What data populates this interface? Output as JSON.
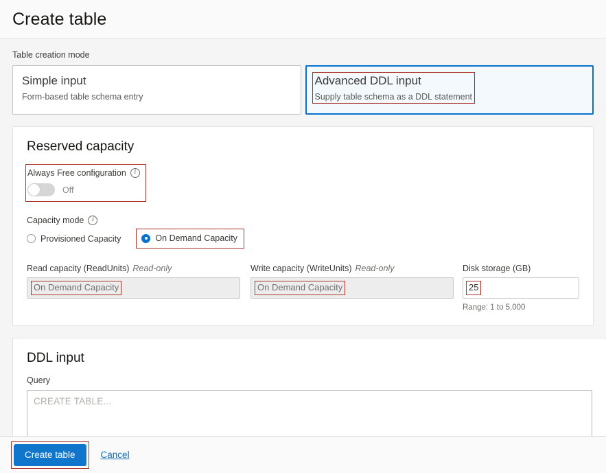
{
  "header": {
    "title": "Create table"
  },
  "creation_mode": {
    "label": "Table creation mode",
    "tiles": [
      {
        "title": "Simple input",
        "subtitle": "Form-based table schema entry",
        "selected": false
      },
      {
        "title": "Advanced DDL input",
        "subtitle": "Supply table schema as a DDL statement",
        "selected": true
      }
    ]
  },
  "reserved_capacity": {
    "title": "Reserved capacity",
    "always_free": {
      "label": "Always Free configuration",
      "info_icon": "info-icon",
      "state": "Off",
      "checked": false
    },
    "capacity_mode": {
      "label": "Capacity mode",
      "info_icon": "info-icon",
      "options": [
        {
          "label": "Provisioned Capacity",
          "selected": false
        },
        {
          "label": "On Demand Capacity",
          "selected": true
        }
      ]
    },
    "read_capacity": {
      "label": "Read capacity (ReadUnits)",
      "readonly_tag": "Read-only",
      "value": "On Demand Capacity"
    },
    "write_capacity": {
      "label": "Write capacity (WriteUnits)",
      "readonly_tag": "Read-only",
      "value": "On Demand Capacity"
    },
    "disk_storage": {
      "label": "Disk storage (GB)",
      "value": "25",
      "hint": "Range: 1 to 5,000"
    }
  },
  "ddl_input": {
    "title": "DDL input",
    "query_label": "Query",
    "query_placeholder": "CREATE TABLE..."
  },
  "footer": {
    "submit_label": "Create table",
    "cancel_label": "Cancel"
  },
  "colors": {
    "accent_blue": "#0f76cc",
    "selected_border": "#0572ce",
    "annotation_red": "#a8342a",
    "link_blue": "#0f6cb8"
  }
}
